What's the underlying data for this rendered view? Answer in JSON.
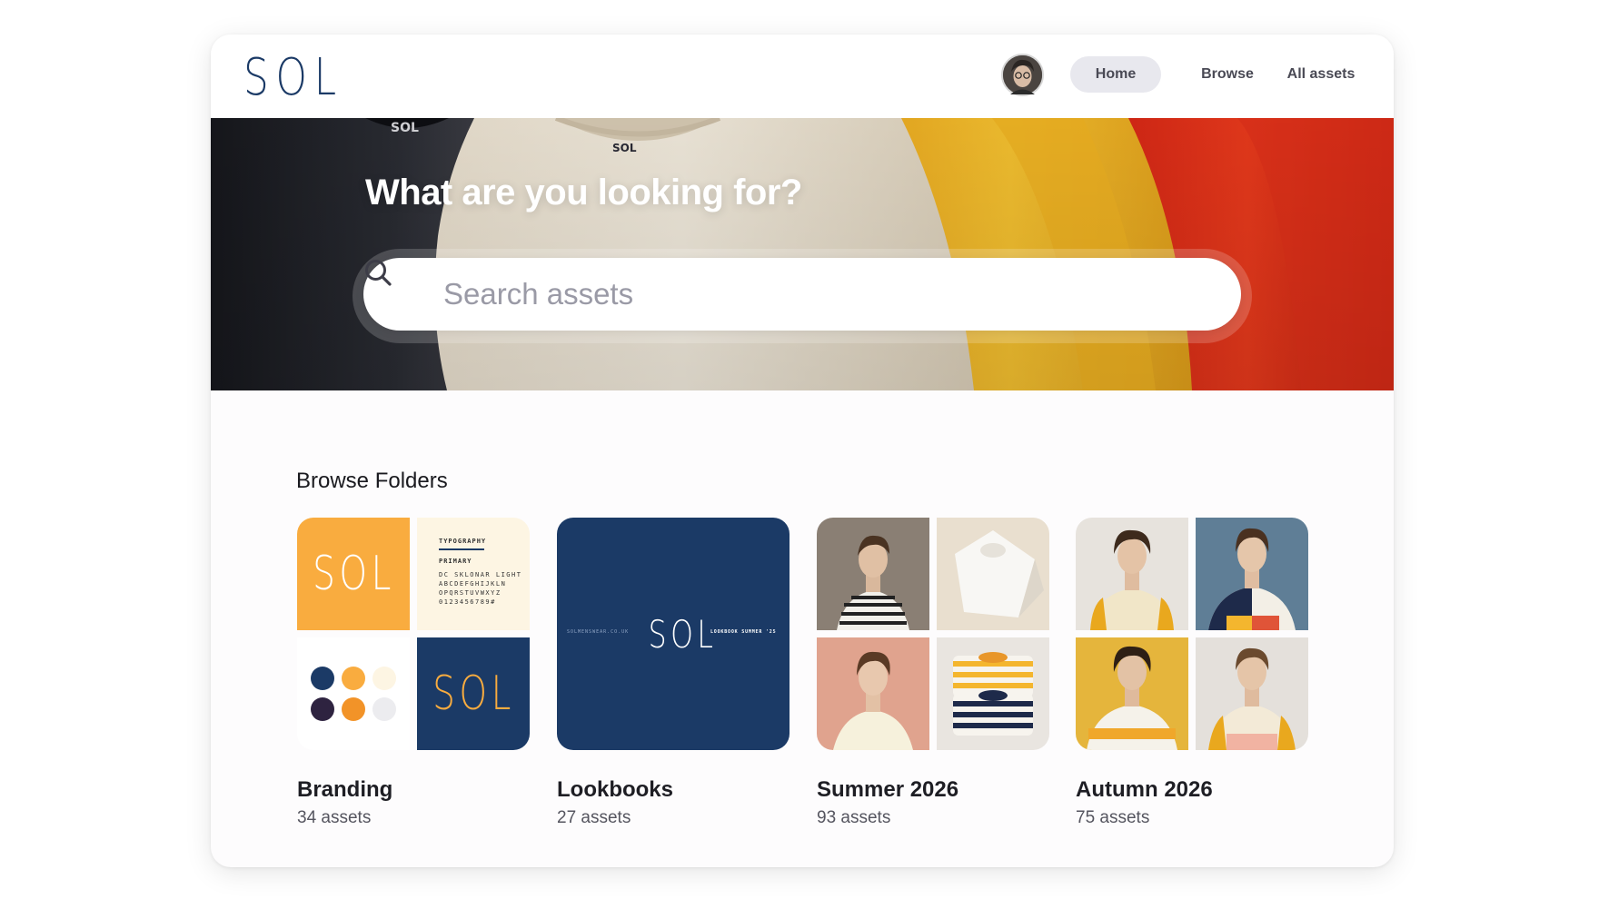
{
  "app": {
    "brand": "SOL"
  },
  "nav": {
    "home": "Home",
    "browse": "Browse",
    "all_assets": "All assets",
    "active": "Home"
  },
  "hero": {
    "title": "What are you looking for?",
    "search_placeholder": "Search assets"
  },
  "section": {
    "title": "Browse Folders"
  },
  "folders": [
    {
      "name": "Branding",
      "count": "34 assets",
      "thumb": {
        "logo_text": "SOL",
        "typography_title": "TYPOGRAPHY",
        "typography_label": "PRIMARY",
        "typography_line1": "DC SKLONAR LIGHT",
        "typography_line2": "ABCDEFGHIJKLN",
        "typography_line3": "OPQRSTUVWXYZ",
        "typography_line4": "0123456789#"
      }
    },
    {
      "name": "Lookbooks",
      "count": "27 assets",
      "thumb": {
        "logo_text": "SOL",
        "left_text": "SOLMENSWEAR.CO.UK",
        "right_text": "LOOKBOOK SUMMER '25"
      }
    },
    {
      "name": "Summer 2026",
      "count": "93 assets"
    },
    {
      "name": "Autumn 2026",
      "count": "75 assets"
    }
  ],
  "colors": {
    "brand_navy": "#1b3a66",
    "brand_orange": "#f9ac3f",
    "brand_cream": "#fdf5e3",
    "palette": [
      "#1b3a66",
      "#f9ac3f",
      "#fdf5e3",
      "#2e2340",
      "#f29328",
      "#ececef"
    ]
  }
}
